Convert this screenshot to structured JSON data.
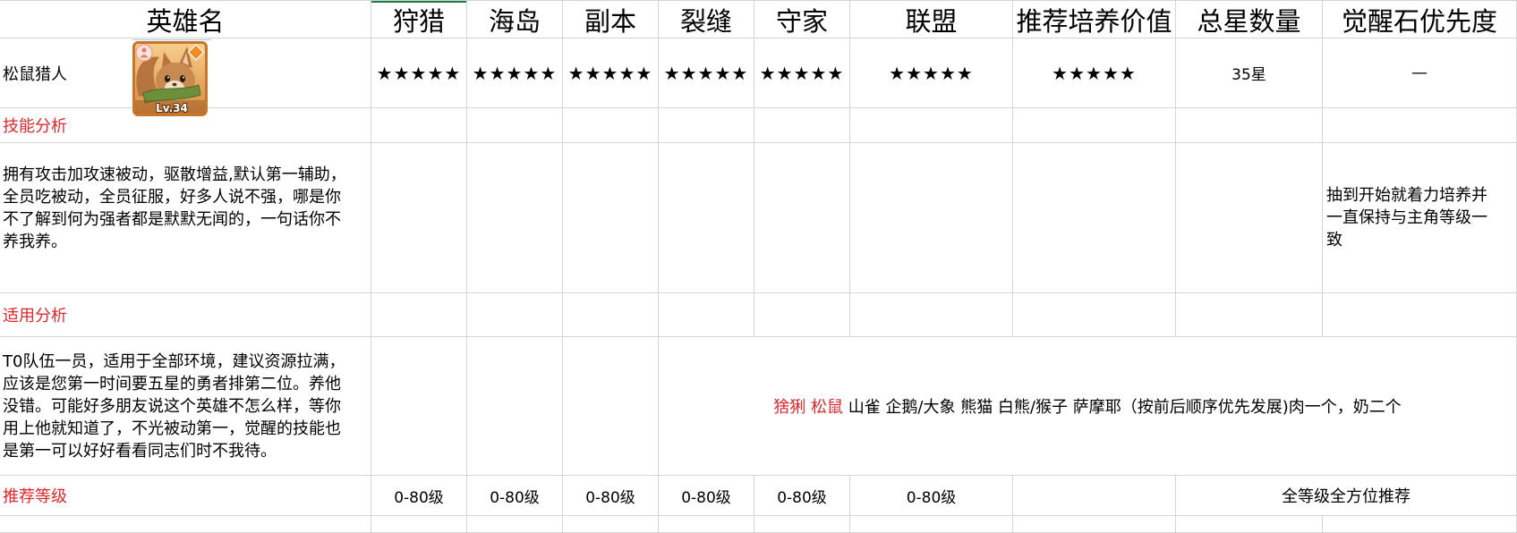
{
  "sheet": {
    "headers": [
      "英雄名",
      "狩猎",
      "海岛",
      "副本",
      "裂缝",
      "守家",
      "联盟",
      "推荐培养价值",
      "总星数量",
      "觉醒石优先度"
    ],
    "hero": {
      "name": "松鼠猎人",
      "portrait_icon": "squirrel-hunter-portrait",
      "portrait_level": "Lv.34",
      "ratings": [
        "★★★★★",
        "★★★★★",
        "★★★★★",
        "★★★★★",
        "★★★★★",
        "★★★★★",
        "★★★★★"
      ],
      "total_stars": "35星",
      "awaken_priority": "—"
    },
    "skill_analysis": {
      "label": "技能分析",
      "text_lines": [
        "拥有攻击加攻速被动，驱散增益,默认第一辅助，",
        "全员吃被动，全员征服，好多人说不强，哪是你",
        "不了解到何为强者都是默默无闻的，一句话你不",
        "养我养。"
      ],
      "awaken_note_lines": [
        "抽到开始就着力培养并",
        "一直保持与主角等级一",
        "致"
      ]
    },
    "usage_analysis": {
      "label": "适用分析",
      "text_lines": [
        "T0队伍一员，适用于全部环境，建议资源拉满，",
        "应该是您第一时间要五星的勇者排第二位。养他",
        "没错。可能好多朋友说这个英雄不怎么样，等你",
        "用上他就知道了，不光被动第一，觉醒的技能也",
        "是第一可以好好看看同志们时不我待。"
      ],
      "team_priority": {
        "highlighted": "猞猁 松鼠",
        "rest": " 山雀 企鹅/大象 熊猫 白熊/猴子 萨摩耶（按前后顺序优先发展)肉一个，奶二个"
      }
    },
    "recommended_level": {
      "label": "推荐等级",
      "levels": [
        "0-80级",
        "0-80级",
        "0-80级",
        "0-80级",
        "0-80级",
        "0-80级"
      ],
      "overall": "全等级全方位推荐"
    }
  },
  "colors": {
    "label_red": "#e3262a",
    "gridline": "#d4d4d4",
    "selected_cell_border": "#1f7a4a",
    "portrait_frame": "#c7762b"
  }
}
